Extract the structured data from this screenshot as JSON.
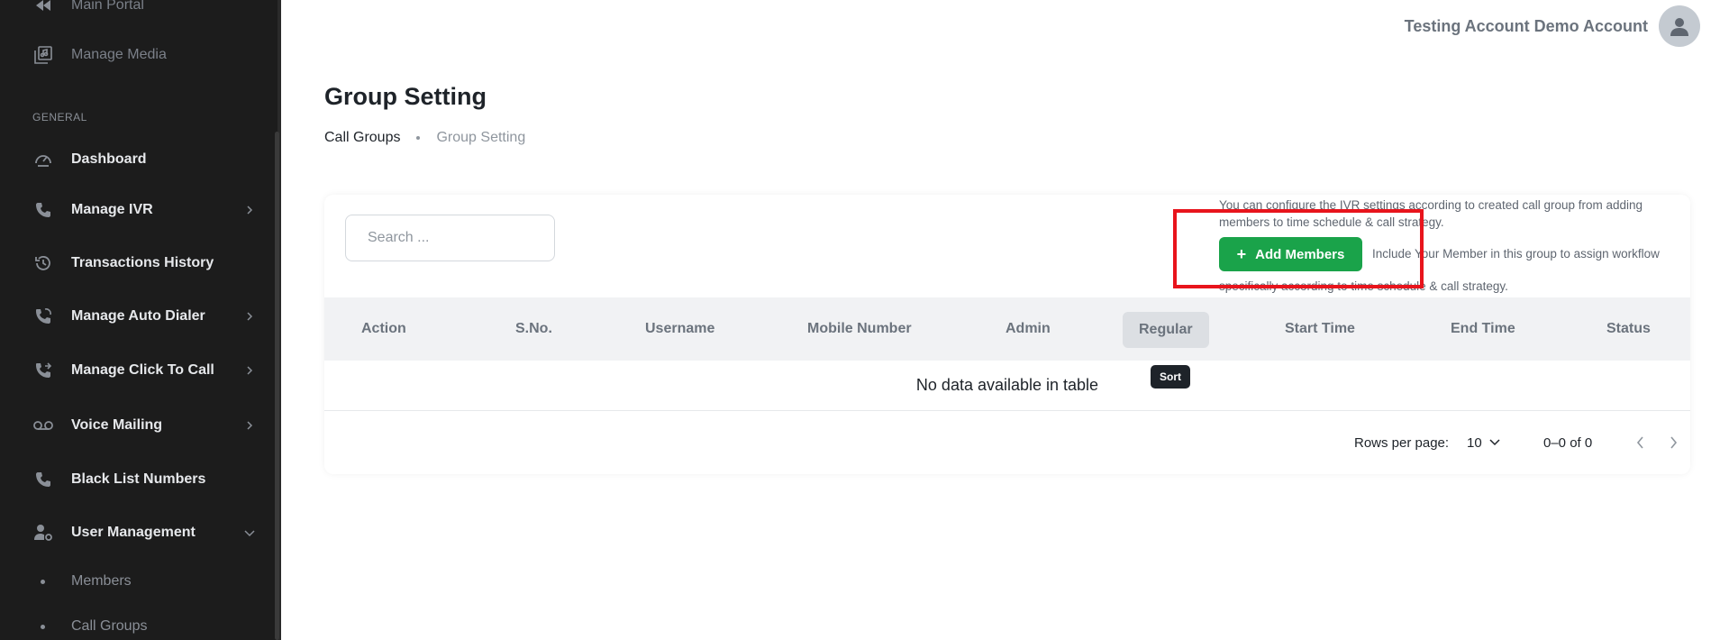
{
  "sidebar": {
    "top_items": [
      {
        "label": "Main Portal",
        "icon": "rewind-icon"
      },
      {
        "label": "Manage Media",
        "icon": "media-icon"
      }
    ],
    "section_title": "GENERAL",
    "items": [
      {
        "label": "Dashboard",
        "icon": "gauge-icon"
      },
      {
        "label": "Manage IVR",
        "icon": "phone-icon"
      },
      {
        "label": "Transactions History",
        "icon": "history-icon"
      },
      {
        "label": "Manage Auto Dialer",
        "icon": "phone-sync-icon"
      },
      {
        "label": "Manage Click To Call",
        "icon": "phone-forward-icon"
      },
      {
        "label": "Voice Mailing",
        "icon": "voicemail-icon"
      },
      {
        "label": "Black List Numbers",
        "icon": "phone-icon"
      },
      {
        "label": "User Management",
        "icon": "user-gear-icon"
      }
    ],
    "sub_items": [
      {
        "label": "Members"
      },
      {
        "label": "Call Groups"
      }
    ]
  },
  "header": {
    "user_name": "Testing Account Demo Account"
  },
  "page": {
    "title": "Group Setting",
    "breadcrumb": {
      "parent": "Call Groups",
      "current": "Group Setting"
    }
  },
  "toolbar": {
    "search_placeholder": "Search ...",
    "info_text": "You can configure the IVR settings according to created call group from adding members to time schedule & call strategy.",
    "add_button_label": "Add Members",
    "include_text": "Include Your Member in this group to assign workflow",
    "include_text_2": "specifically according to time schedule & call strategy."
  },
  "table": {
    "columns": [
      "Action",
      "S.No.",
      "Username",
      "Mobile Number",
      "Admin",
      "Regular",
      "Start Time",
      "End Time",
      "Status"
    ],
    "empty_message": "No data available in table",
    "tooltip": "Sort"
  },
  "pagination": {
    "rows_label": "Rows per page:",
    "rows_value": "10",
    "range": "0–0 of 0"
  },
  "colors": {
    "sidebar_bg": "#1c1c1c",
    "accent_green": "#1aa34a",
    "highlight_red": "#e8141c"
  }
}
